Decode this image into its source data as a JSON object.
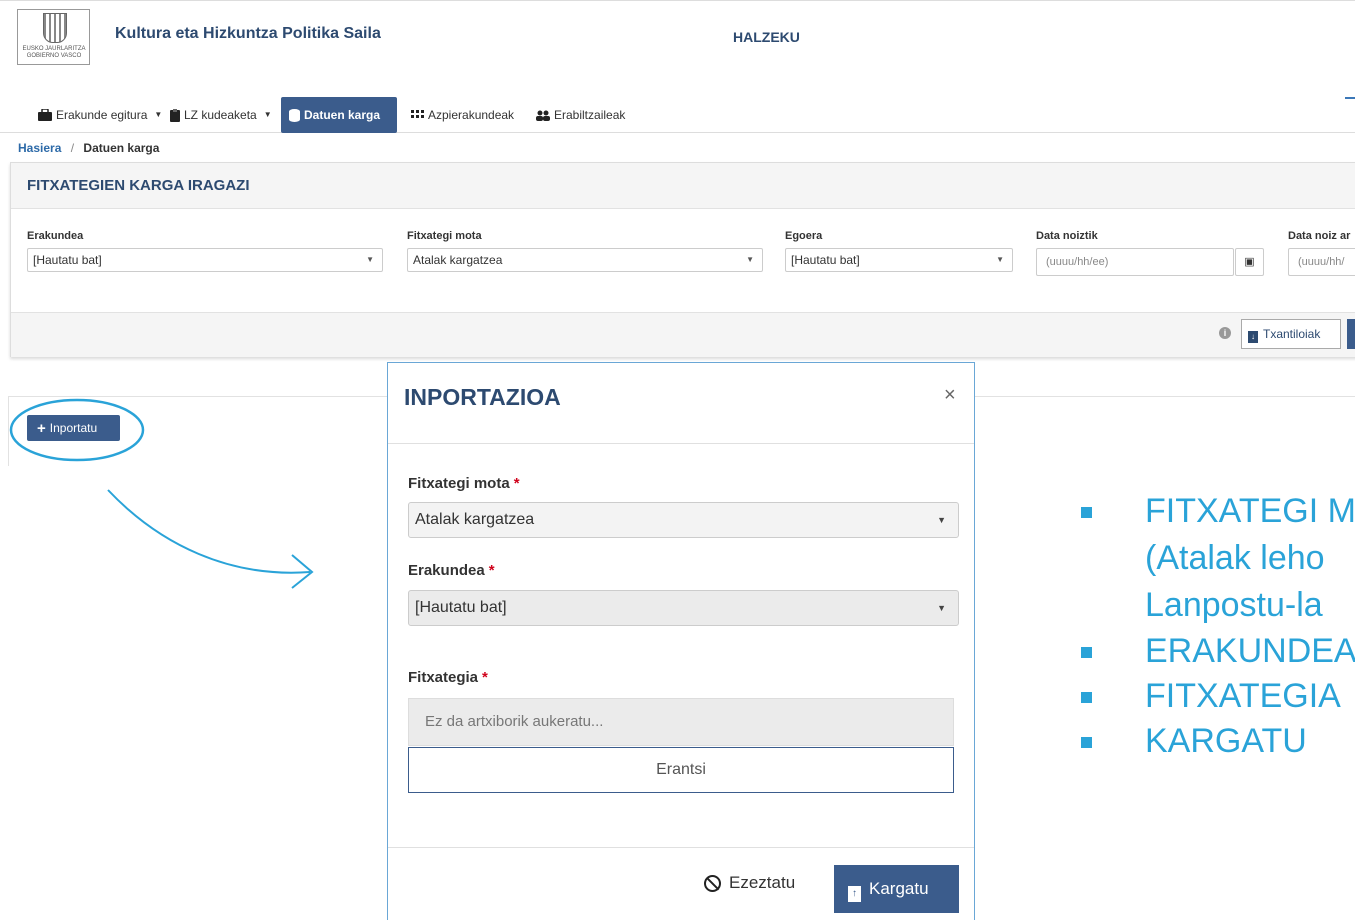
{
  "header": {
    "logo_lines": [
      "EUSKO JAURLARITZA",
      "GOBIERNO VASCO"
    ],
    "dept_title": "Kultura eta Hizkuntza Politika Saila",
    "app_title": "HALZEKU"
  },
  "nav": {
    "items": [
      {
        "label": "Erakunde egitura",
        "icon": "briefcase-icon",
        "dropdown": true
      },
      {
        "label": "LZ kudeaketa",
        "icon": "clipboard-icon",
        "dropdown": true
      },
      {
        "label": "Datuen karga",
        "icon": "database-icon",
        "active": true
      },
      {
        "label": "Azpierakundeak",
        "icon": "grid-icon"
      },
      {
        "label": "Erabiltzaileak",
        "icon": "users-icon"
      }
    ]
  },
  "breadcrumb": {
    "home": "Hasiera",
    "separator": "/",
    "current": "Datuen karga"
  },
  "filter_panel": {
    "title": "FITXATEGIEN KARGA IRAGAZI",
    "fields": {
      "erakundea": {
        "label": "Erakundea",
        "value": "[Hautatu bat]"
      },
      "fitxategi_mota": {
        "label": "Fitxategi mota",
        "value": "Atalak kargatzea"
      },
      "egoera": {
        "label": "Egoera",
        "value": "[Hautatu bat]"
      },
      "data_noiztik": {
        "label": "Data noiztik",
        "placeholder": "(uuuu/hh/ee)"
      },
      "data_noiz_arte": {
        "label": "Data noiz ar",
        "placeholder": "(uuuu/hh/"
      }
    },
    "templates_button": "Txantiloiak"
  },
  "import_button": {
    "label": "Inportatu"
  },
  "modal": {
    "title": "INPORTAZIOA",
    "close": "×",
    "required_mark": "*",
    "file_type": {
      "label": "Fitxategi mota",
      "value": "Atalak kargatzea"
    },
    "organization": {
      "label": "Erakundea",
      "value": "[Hautatu bat]"
    },
    "file": {
      "label": "Fitxategia",
      "placeholder": "Ez da artxiborik aukeratu...",
      "browse": "Erantsi"
    },
    "cancel": "Ezeztatu",
    "upload": "Kargatu"
  },
  "instructions": {
    "lines": [
      "FITXATEGI M",
      "(Atalak leho",
      "Lanpostu-la",
      "ERAKUNDEA",
      "FITXATEGIA",
      "KARGATU"
    ]
  },
  "colors": {
    "primary": "#3b5c8c",
    "title": "#2d4a70",
    "annotation": "#2aa3d8",
    "required": "#d0021b"
  }
}
